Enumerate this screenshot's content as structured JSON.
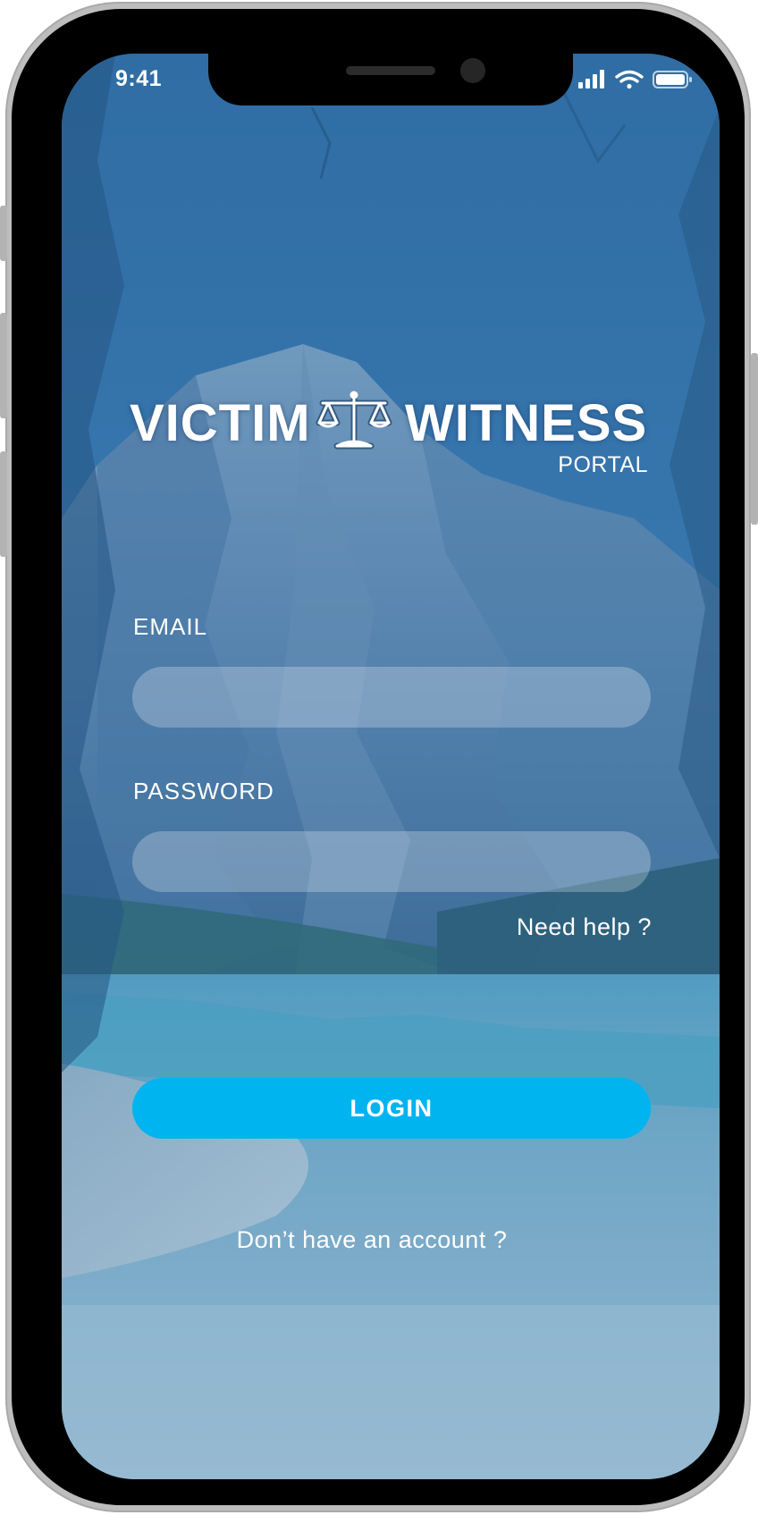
{
  "status_bar": {
    "time": "9:41",
    "icons": [
      "cellular-signal-icon",
      "wifi-icon",
      "battery-icon"
    ]
  },
  "logo": {
    "word_left": "VICTIM",
    "word_right": "WITNESS",
    "subtitle": "PORTAL",
    "emblem": "scales-of-justice-icon"
  },
  "form": {
    "email_label": "EMAIL",
    "email_value": "",
    "email_placeholder": "",
    "password_label": "PASSWORD",
    "password_value": "",
    "password_placeholder": "",
    "help_link": "Need help ?",
    "login_label": "LOGIN",
    "signup_link": "Don’t have an account ?"
  },
  "colors": {
    "accent": "#00B4F0",
    "overlay": "#306EAA",
    "text": "#FFFFFF"
  }
}
